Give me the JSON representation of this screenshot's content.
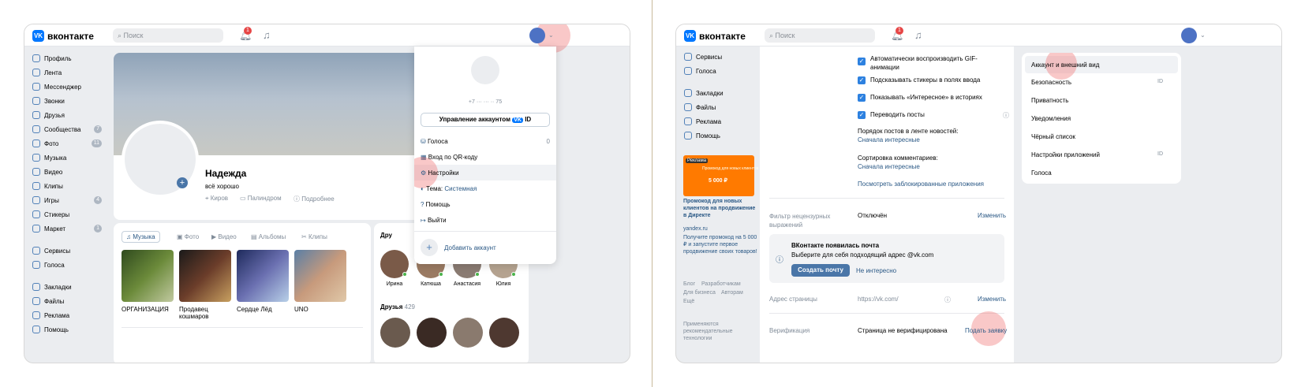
{
  "left": {
    "logo": "вконтакте",
    "search_placeholder": "Поиск",
    "notif_count": "1",
    "sidebar": [
      {
        "label": "Профиль"
      },
      {
        "label": "Лента"
      },
      {
        "label": "Мессенджер"
      },
      {
        "label": "Звонки"
      },
      {
        "label": "Друзья"
      },
      {
        "label": "Сообщества",
        "count": "7"
      },
      {
        "label": "Фото",
        "count": "11"
      },
      {
        "label": "Музыка"
      },
      {
        "label": "Видео"
      },
      {
        "label": "Клипы"
      },
      {
        "label": "Игры",
        "count": "4"
      },
      {
        "label": "Стикеры"
      },
      {
        "label": "Маркет",
        "count": "1"
      },
      {
        "label": "Сервисы"
      },
      {
        "label": "Голоса"
      },
      {
        "label": "Закладки"
      },
      {
        "label": "Файлы"
      },
      {
        "label": "Реклама"
      },
      {
        "label": "Помощь"
      }
    ],
    "profile": {
      "name": "Надежда",
      "status": "всё хорошо",
      "city": "Киров",
      "work": "Палиндром",
      "more": "Подробнее"
    },
    "media_tabs": [
      "Музыка",
      "Фото",
      "Видео",
      "Альбомы",
      "Клипы"
    ],
    "albums": [
      {
        "title": "ОРГАНИЗАЦИЯ"
      },
      {
        "title": "Продавец кошмаров"
      },
      {
        "title": "Сердце Лёд"
      },
      {
        "title": "UNO"
      }
    ],
    "friends_online_label": "Дру",
    "friends_online": [
      "Ирина",
      "Катюша",
      "Анастасия",
      "Юлия"
    ],
    "friends_label": "Друзья",
    "friends_count": "429",
    "dropdown": {
      "phone": "+7 ··· ··· ·· 75",
      "manage": "Управление аккаунтом",
      "id": "ID",
      "items": [
        {
          "label": "Голоса",
          "value": "0"
        },
        {
          "label": "Вход по QR-коду"
        },
        {
          "label": "Настройки"
        },
        {
          "label": "Тема: ",
          "value": "Системная"
        },
        {
          "label": "Помощь"
        },
        {
          "label": "Выйти"
        }
      ],
      "add_account": "Добавить аккаунт"
    }
  },
  "right": {
    "logo": "вконтакте",
    "search_placeholder": "Поиск",
    "notif_count": "1",
    "sidebar": [
      {
        "label": "Сервисы"
      },
      {
        "label": "Голоса"
      },
      {
        "label": "Закладки"
      },
      {
        "label": "Файлы"
      },
      {
        "label": "Реклама"
      },
      {
        "label": "Помощь"
      }
    ],
    "ad": {
      "badge": "Реклама",
      "banner_text": "Промокод для новых клиентов",
      "amount": "5 000 ₽",
      "title": "Промокод для новых клиентов на продвижение в Директе",
      "domain": "yandex.ru",
      "desc": "Получите промокод на 5 000 ₽ и запустите первое продвижение своих товаров!"
    },
    "footer_links": [
      "Блог",
      "Разработчикам",
      "Для бизнеса",
      "Авторам",
      "Ещё"
    ],
    "footer_note": "Применяются рекомендательные технологии",
    "checkboxes": [
      "Автоматически воспроизводить GIF-анимации",
      "Подсказывать стикеры в полях ввода",
      "Показывать «Интересное» в историях",
      "Переводить посты"
    ],
    "feed_order_label": "Порядок постов в ленте новостей:",
    "feed_order_value": "Сначала интересные",
    "comments_label": "Сортировка комментариев:",
    "comments_value": "Сначала интересные",
    "blocked_link": "Посмотреть заблокированные приложения",
    "filter_label": "Фильтр нецензурных выражений",
    "filter_value": "Отключён",
    "change": "Изменить",
    "mail": {
      "title": "ВКонтакте появилась почта",
      "desc": "Выберите для себя подходящий адрес @vk.com",
      "create": "Создать почту",
      "skip": "Не интересно"
    },
    "address_label": "Адрес страницы",
    "address_value": "https://vk.com/",
    "verify_label": "Верификация",
    "verify_value": "Страница не верифицирована",
    "verify_action": "Подать заявку",
    "menu": [
      {
        "label": "Аккаунт и внешний вид"
      },
      {
        "label": "Безопасность",
        "tag": "ID"
      },
      {
        "label": "Приватность"
      },
      {
        "label": "Уведомления"
      },
      {
        "label": "Чёрный список"
      },
      {
        "label": "Настройки приложений",
        "tag": "ID"
      },
      {
        "label": "Голоса"
      }
    ]
  }
}
